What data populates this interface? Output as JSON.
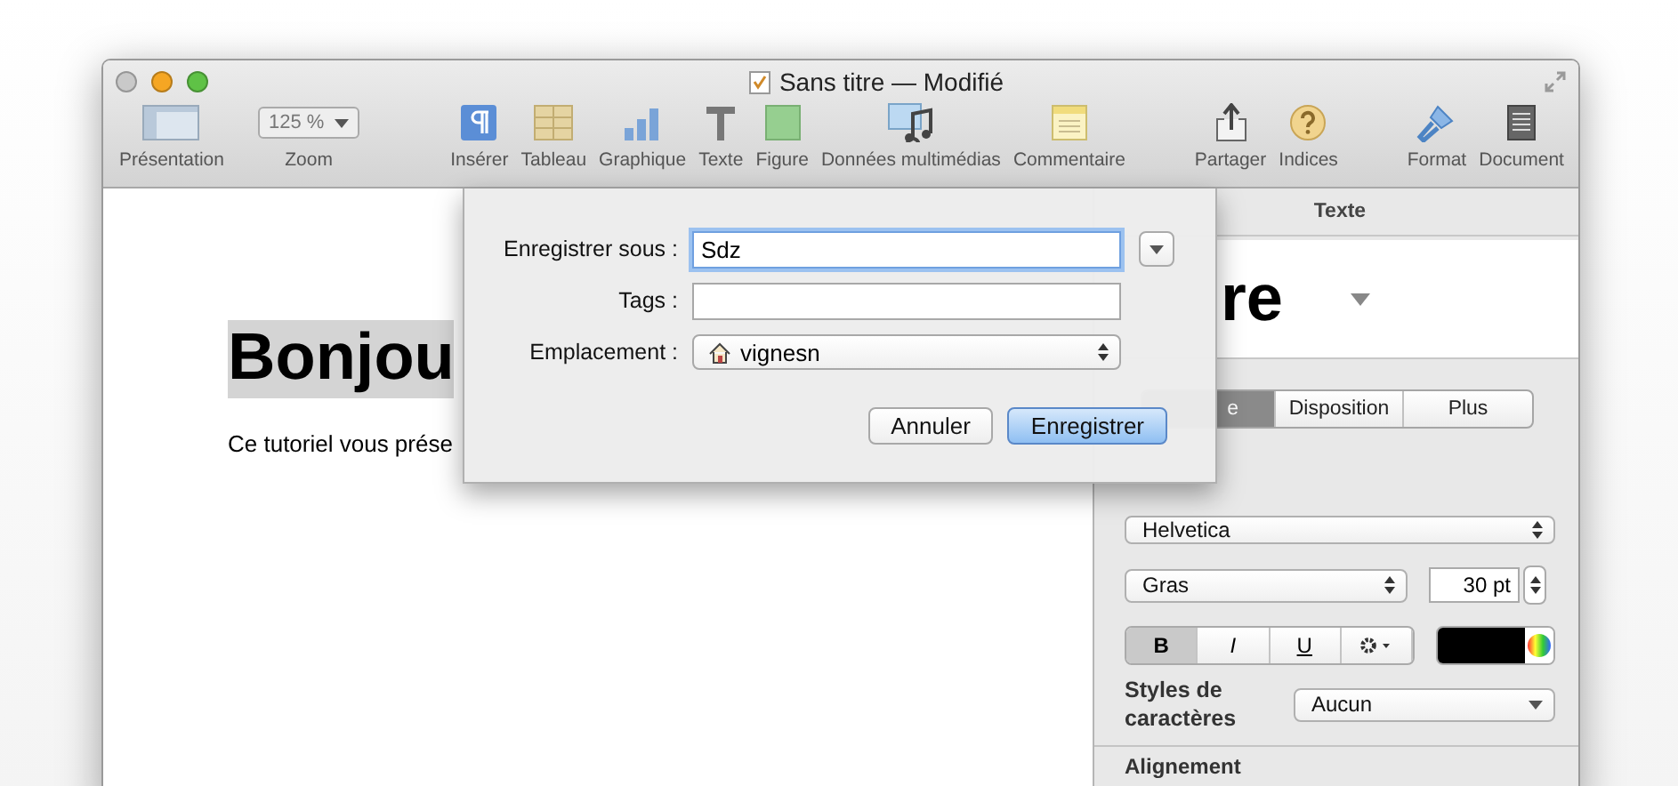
{
  "window": {
    "title": "Sans titre — Modifié"
  },
  "toolbar": {
    "groups": [
      [
        {
          "kind": "button",
          "label": "Présentation"
        },
        {
          "kind": "dropdown",
          "label": "Zoom",
          "value": "125 %"
        }
      ],
      [
        {
          "kind": "button",
          "label": "Insérer"
        },
        {
          "kind": "button",
          "label": "Tableau"
        },
        {
          "kind": "button",
          "label": "Graphique"
        },
        {
          "kind": "button",
          "label": "Texte"
        },
        {
          "kind": "button",
          "label": "Figure"
        },
        {
          "kind": "button",
          "label": "Données multimédias"
        },
        {
          "kind": "button",
          "label": "Commentaire"
        }
      ],
      [
        {
          "kind": "button",
          "label": "Partager"
        },
        {
          "kind": "button",
          "label": "Indices"
        }
      ],
      [
        {
          "kind": "button",
          "label": "Format"
        },
        {
          "kind": "button",
          "label": "Document"
        }
      ]
    ]
  },
  "document": {
    "heading": "Bonjou",
    "body": "Ce tutoriel vous prése"
  },
  "save_dialog": {
    "fields": [
      {
        "kind": "text",
        "label": "Enregistrer sous :",
        "value": "Sdz",
        "focused": true
      },
      {
        "kind": "text",
        "label": "Tags :",
        "focused": false
      },
      {
        "kind": "popup",
        "label": "Emplacement :",
        "value": "vignesn"
      }
    ],
    "buttons": [
      {
        "label": "Annuler",
        "default": false
      },
      {
        "label": "Enregistrer",
        "default": true
      }
    ]
  },
  "inspector": {
    "title": "Texte",
    "style_preview": "re",
    "tabs": [
      {
        "label": "e",
        "selected": true
      },
      {
        "label": "Disposition",
        "selected": false
      },
      {
        "label": "Plus",
        "selected": false
      }
    ],
    "font": "Helvetica",
    "typeface": "Gras",
    "size": "30 pt",
    "styles": [
      {
        "label": "B",
        "selected": true
      },
      {
        "label": "I",
        "selected": false
      },
      {
        "label": "U",
        "selected": false
      }
    ],
    "color": "#000000",
    "char_styles_label": "Styles de caractères",
    "char_style": "Aucun",
    "next_section": "Alignement"
  }
}
